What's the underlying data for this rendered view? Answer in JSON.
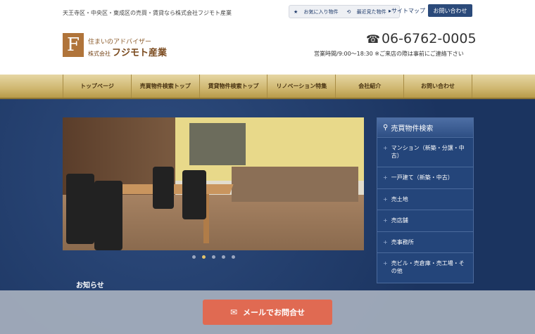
{
  "header": {
    "tagline": "天王寺区・中央区・東成区の売買・賃貸なら株式会社フジモト産業",
    "favorites_label": "お気に入り物件",
    "recent_label": "最近見た物件",
    "sitemap_label": "サイトマップ",
    "contact_label": "お問い合わせ",
    "logo_mark": "F",
    "logo_sub": "住まいのアドバイザー",
    "logo_company_prefix": "株式会社",
    "logo_company_name": "フジモト産業",
    "phone": "06-6762-0005",
    "phone_icon": "☎",
    "hours": "営業時間/9:00～18:30 ※ご来店の際は事前にご連絡下さい"
  },
  "nav": {
    "items": [
      "トップページ",
      "売買物件検索トップ",
      "賃貸物件検索トップ",
      "リノベーション特集",
      "会社紹介",
      "お問い合わせ"
    ]
  },
  "carousel": {
    "slide_count": 5,
    "active_index": 1
  },
  "news": {
    "title": "お知らせ"
  },
  "sidebar": {
    "title": "売買物件検索",
    "items": [
      "マンション（新築・分譲・中古）",
      "一戸建て（新築・中古）",
      "売土地",
      "売店舗",
      "売事務所",
      "売ビル・売倉庫・売工場・その他"
    ]
  },
  "footer_bar": {
    "mail_button_label": "メールでお問合せ"
  },
  "colors": {
    "nav_gold": "#cfb770",
    "main_blue": "#1b3460",
    "mail_button": "#e06a52"
  }
}
